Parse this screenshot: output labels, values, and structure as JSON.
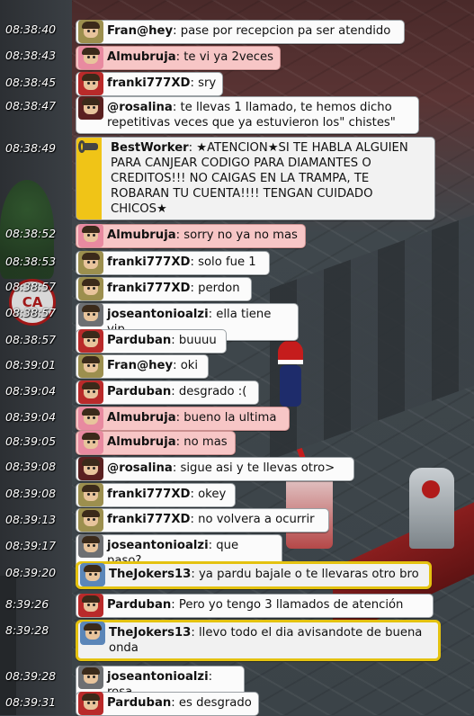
{
  "app": {
    "room_sign_text": "CA"
  },
  "messages": [
    {
      "time": "08:38:40",
      "user": "Fran@hey",
      "text": "pase por recepcion pa ser atendido",
      "style": "white",
      "avatar": "av-olive"
    },
    {
      "time": "08:38:43",
      "user": "Almubruja",
      "text": "te vi ya 2veces",
      "style": "pink",
      "avatar": "av-pink"
    },
    {
      "time": "08:38:45",
      "user": "franki777XD",
      "text": "sry",
      "style": "white",
      "avatar": "av-red"
    },
    {
      "time": "08:38:47",
      "user": "@rosalina",
      "text": "te llevas 1 llamado, te hemos dicho repetitivas veces que ya estuvieron los\" chistes\"",
      "style": "white",
      "avatar": "av-dark"
    },
    {
      "time": "08:38:49",
      "user": "BestWorker",
      "text": "★ATENCION★SI TE HABLA ALGUIEN PARA CANJEAR CODIGO PARA DIAMANTES O CREDITOS!!! NO CAIGAS EN LA TRAMPA, TE ROBARAN TU CUENTA!!!! TENGAN CUIDADO CHICOS★",
      "style": "staff",
      "avatar": "av-wrench"
    },
    {
      "time": "08:38:52",
      "user": "Almubruja",
      "text": "sorry no ya no mas",
      "style": "pink",
      "avatar": "av-pink"
    },
    {
      "time": "08:38:53",
      "user": "franki777XD",
      "text": "solo fue 1",
      "style": "white",
      "avatar": "av-olive"
    },
    {
      "time": "08:38:57",
      "user": "franki777XD",
      "text": "perdon",
      "style": "white",
      "avatar": "av-olive"
    },
    {
      "time": "08:38:57",
      "user": "joseantonioalzi",
      "text": "ella tiene vip",
      "style": "white",
      "avatar": "av-gray"
    },
    {
      "time": "08:38:57",
      "user": "Parduban",
      "text": "buuuu",
      "style": "white",
      "avatar": "av-red"
    },
    {
      "time": "08:39:01",
      "user": "Fran@hey",
      "text": "oki",
      "style": "white",
      "avatar": "av-olive"
    },
    {
      "time": "08:39:04",
      "user": "Parduban",
      "text": "desgrado :(",
      "style": "white",
      "avatar": "av-red"
    },
    {
      "time": "08:39:04",
      "user": "Almubruja",
      "text": "bueno la ultima",
      "style": "pink",
      "avatar": "av-pink"
    },
    {
      "time": "08:39:05",
      "user": "Almubruja",
      "text": "no mas",
      "style": "pink",
      "avatar": "av-pink"
    },
    {
      "time": "08:39:08",
      "user": "@rosalina",
      "text": "sigue asi y te llevas otro>",
      "style": "white",
      "avatar": "av-dark"
    },
    {
      "time": "08:39:08",
      "user": "franki777XD",
      "text": "okey",
      "style": "white",
      "avatar": "av-olive"
    },
    {
      "time": "08:39:13",
      "user": "franki777XD",
      "text": "no volvera a ocurrir",
      "style": "white",
      "avatar": "av-olive"
    },
    {
      "time": "08:39:17",
      "user": "joseantonioalzi",
      "text": "que paso?",
      "style": "white",
      "avatar": "av-gray"
    },
    {
      "time": "08:39:20",
      "user": "TheJokers13",
      "text": "ya pardu bajale o te llevaras otro bro",
      "style": "gold",
      "avatar": "av-blue"
    },
    {
      "time": "8:39:26",
      "user": "Parduban",
      "text": "Pero yo tengo 3 llamados de atención",
      "style": "white",
      "avatar": "av-red"
    },
    {
      "time": "8:39:28",
      "user": "TheJokers13",
      "text": "llevo todo el dia avisandote de buena onda",
      "style": "gold",
      "avatar": "av-blue"
    },
    {
      "time": "08:39:28",
      "user": "joseantonioalzi",
      "text": "rosa",
      "style": "white",
      "avatar": "av-gray"
    },
    {
      "time": "08:39:31",
      "user": "Parduban",
      "text": "es desgrado",
      "style": "white",
      "avatar": "av-red"
    }
  ]
}
